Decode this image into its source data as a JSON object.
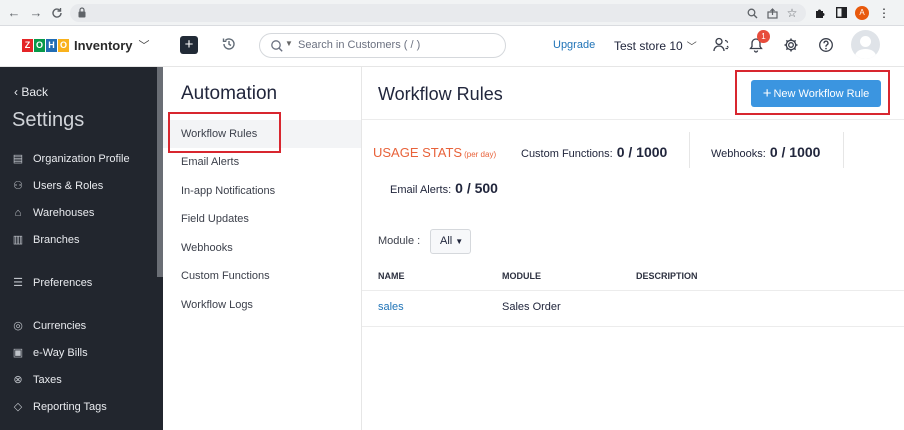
{
  "browser": {
    "nav": {
      "back": "←",
      "forward": "→",
      "reload": "C"
    },
    "profile_initial": "A"
  },
  "app": {
    "logo_letters": [
      "Z",
      "O",
      "H",
      "O"
    ],
    "logo_colors": [
      "#e42527",
      "#089949",
      "#226db4",
      "#f9b21d"
    ],
    "product": "Inventory",
    "search_placeholder": "Search in Customers ( / )",
    "upgrade": "Upgrade",
    "store": "Test store 10",
    "notification_count": "1"
  },
  "sidebar": {
    "back": "Back",
    "title": "Settings",
    "items": [
      {
        "label": "Organization Profile",
        "icon": "building-icon"
      },
      {
        "label": "Users & Roles",
        "icon": "users-icon"
      },
      {
        "label": "Warehouses",
        "icon": "warehouse-icon"
      },
      {
        "label": "Branches",
        "icon": "branches-icon"
      },
      {
        "label": "Preferences",
        "icon": "sliders-icon"
      },
      {
        "label": "Currencies",
        "icon": "currency-icon"
      },
      {
        "label": "e-Way Bills",
        "icon": "truck-icon"
      },
      {
        "label": "Taxes",
        "icon": "percent-icon"
      },
      {
        "label": "Reporting Tags",
        "icon": "tag-icon"
      }
    ]
  },
  "subnav": {
    "title": "Automation",
    "items": [
      "Workflow Rules",
      "Email Alerts",
      "In-app Notifications",
      "Field Updates",
      "Webhooks",
      "Custom Functions",
      "Workflow Logs"
    ]
  },
  "main": {
    "title": "Workflow Rules",
    "new_button": "New Workflow Rule",
    "usage": {
      "label": "USAGE STATS",
      "sub": "(per day)",
      "custom_functions_label": "Custom Functions:",
      "custom_functions_value": "0 / 1000",
      "webhooks_label": "Webhooks:",
      "webhooks_value": "0 / 1000",
      "email_alerts_label": "Email Alerts:",
      "email_alerts_value": "0 / 500"
    },
    "filter": {
      "label": "Module :",
      "selected": "All"
    },
    "table": {
      "columns": [
        "NAME",
        "MODULE",
        "DESCRIPTION"
      ],
      "rows": [
        {
          "name": "sales",
          "module": "Sales Order",
          "description": ""
        }
      ]
    }
  },
  "colors": {
    "accent": "#3b95e0",
    "highlight_box": "#d8262f",
    "sidebar_bg": "#22262e",
    "usage_orange": "#e8623a"
  }
}
